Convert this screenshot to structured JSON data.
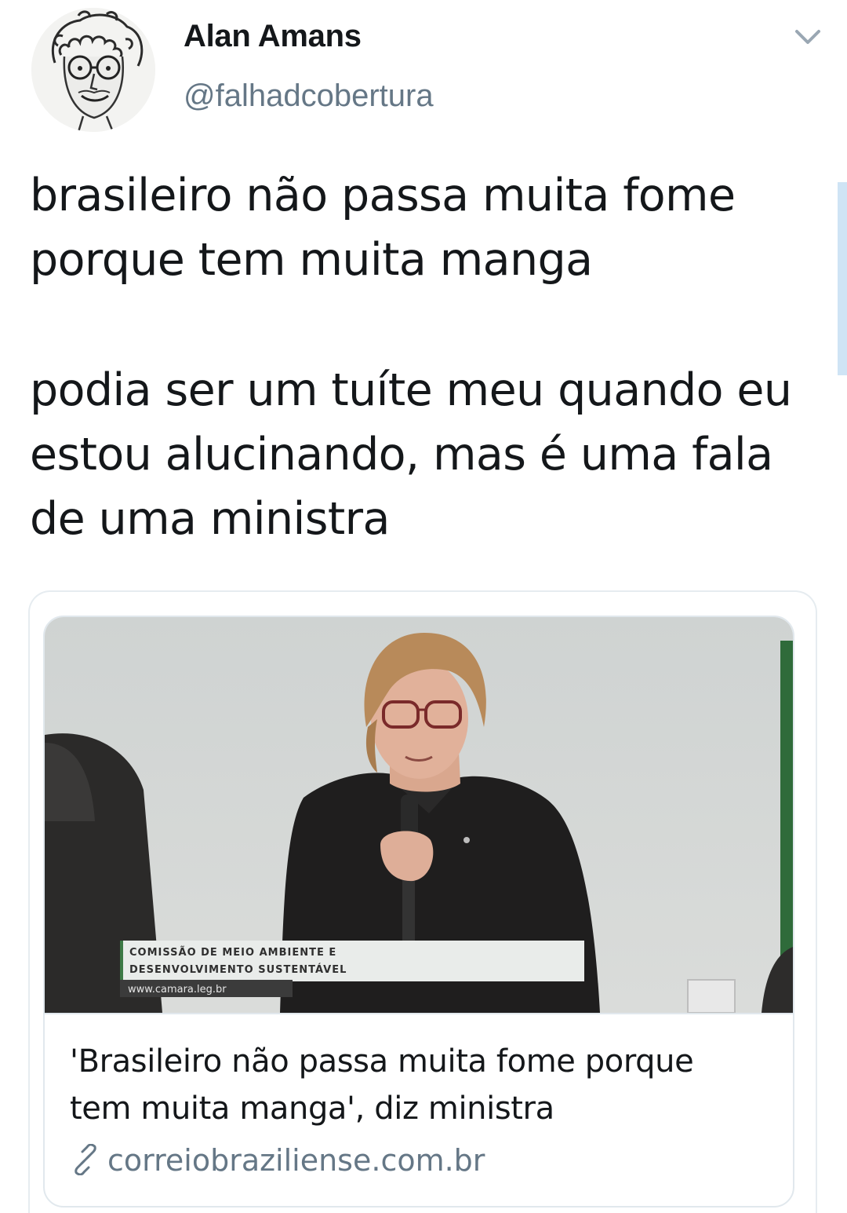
{
  "tweet": {
    "author": {
      "display_name": "Alan Amans",
      "handle": "@falhadcobertura"
    },
    "menu_icon": "chevron-down-icon",
    "text_paragraph_1": [
      "brasileiro não passa muita fome",
      "porque tem muita manga"
    ],
    "text_paragraph_2": [
      "podia ser um tuíte meu quando eu",
      "estou alucinando, mas é uma fala",
      "de uma ministra"
    ]
  },
  "link_card": {
    "image_caption": {
      "line_1": "COMISSÃO DE MEIO AMBIENTE E",
      "line_2": "DESENVOLVIMENTO SUSTENTÁVEL",
      "url": "www.camara.leg.br"
    },
    "title_lines": [
      "'Brasileiro não passa muita fome porque",
      "tem muita manga', diz ministra"
    ],
    "domain": "correiobraziliense.com.br",
    "link_icon": "link-icon"
  },
  "colors": {
    "text": "#14171a",
    "secondary": "#657786",
    "border": "#e1e8ed",
    "scroll_indicator": "#cfe4f5"
  }
}
